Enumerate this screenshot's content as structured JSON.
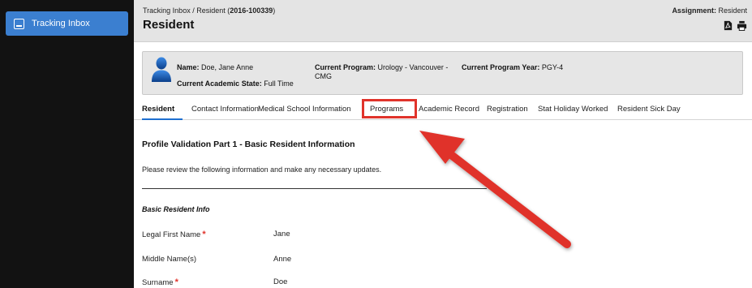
{
  "sidebar": {
    "tracking_inbox_label": "Tracking Inbox"
  },
  "header": {
    "breadcrumb_prefix": "Tracking Inbox / Resident (",
    "breadcrumb_id": "2016-100339",
    "breadcrumb_suffix": ")",
    "title": "Resident",
    "assignment_label": "Assignment:",
    "assignment_value": "Resident"
  },
  "profile": {
    "name_label": "Name:",
    "name_value": "Doe, Jane Anne",
    "academic_state_label": "Current Academic State:",
    "academic_state_value": "Full Time",
    "program_label": "Current Program:",
    "program_value_line1": "Urology - Vancouver -",
    "program_value_line2": "CMG",
    "program_year_label": "Current Program Year:",
    "program_year_value": "PGY-4"
  },
  "tabs": [
    {
      "label": "Resident"
    },
    {
      "label": "Contact Information"
    },
    {
      "label": "Medical School Information"
    },
    {
      "label": "Programs"
    },
    {
      "label": "Academic Record"
    },
    {
      "label": "Registration"
    },
    {
      "label": "Stat Holiday Worked"
    },
    {
      "label": "Resident Sick Day"
    }
  ],
  "section": {
    "title": "Profile Validation Part 1 - Basic Resident Information",
    "description": "Please review the following information and make any necessary updates.",
    "group_title": "Basic Resident Info",
    "required_marker": "*",
    "fields": [
      {
        "label": "Legal First Name",
        "value": "Jane"
      },
      {
        "label": "Middle Name(s)",
        "value": "Anne"
      },
      {
        "label": "Surname",
        "value": "Doe"
      }
    ]
  },
  "colors": {
    "accent": "#3b7fd0",
    "annotation_red": "#e0332b",
    "sidebar_bg": "#121212"
  }
}
